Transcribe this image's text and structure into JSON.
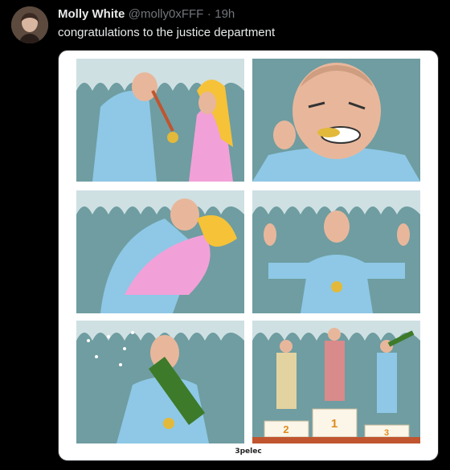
{
  "tweet": {
    "author_name": "Molly White",
    "author_handle": "@molly0xFFF",
    "separator": "·",
    "time": "19h",
    "text": "congratulations to the justice department"
  },
  "comic": {
    "credit": "3pelec",
    "podium_labels": [
      "2",
      "1",
      "3"
    ]
  },
  "colors": {
    "background": "#000000",
    "primary_text": "#e7e9ea",
    "secondary_text": "#71767b",
    "crowd": "#6f9da1",
    "tracksuit": "#8ec8e6",
    "medal": "#e2b93b",
    "dress": "#f2a0d8",
    "hair": "#f6c238",
    "bottle": "#3d7a2a"
  },
  "icons": [
    "avatar-photo",
    "comic-illustration"
  ]
}
